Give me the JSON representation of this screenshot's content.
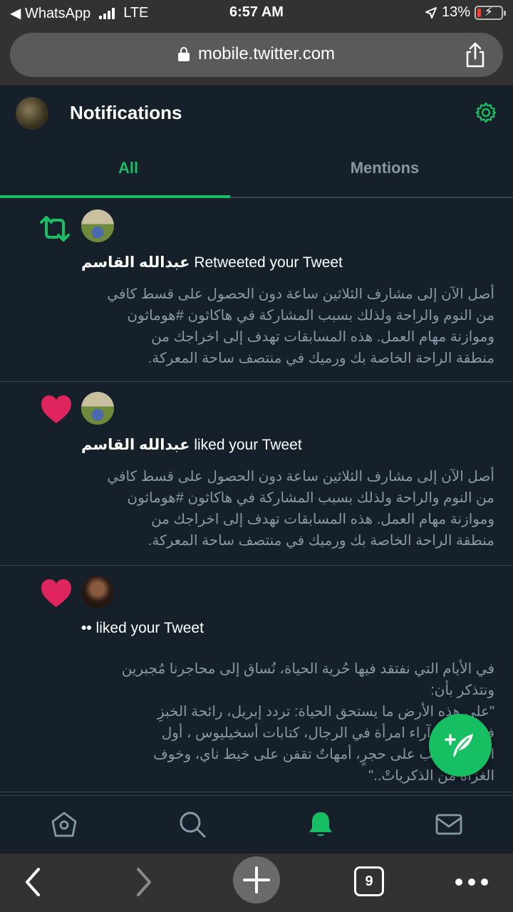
{
  "status_bar": {
    "back_app": "◀ WhatsApp",
    "carrier": "LTE",
    "time": "6:57 AM",
    "battery": "13%"
  },
  "browser": {
    "url": "mobile.twitter.com",
    "tab_count": "9"
  },
  "header": {
    "title": "Notifications"
  },
  "tabs": [
    {
      "label": "All",
      "active": true
    },
    {
      "label": "Mentions",
      "active": false
    }
  ],
  "notifications": [
    {
      "type": "retweet",
      "actor": "عبدالله القاسم",
      "action": " Retweeted your Tweet",
      "tweet_lines": [
        "أصل الآن إلى مشارف الثلاثين ساعة دون الحصول على قسط كافي",
        "من النوم والراحة ولذلك بسبب المشاركة في هاكاثون #هوماثون",
        "وموازنة مهام العمل. هذه المسابقات تهدف إلى اخراجك من",
        "منطقة الراحة الخاصة بك ورميك في منتصف ساحة المعركة."
      ]
    },
    {
      "type": "like",
      "actor": "عبدالله القاسم",
      "action": " liked your Tweet",
      "tweet_lines": [
        "أصل الآن إلى مشارف الثلاثين ساعة دون الحصول على قسط كافي",
        "من النوم والراحة ولذلك بسبب المشاركة في هاكاثون #هوماثون",
        "وموازنة مهام العمل. هذه المسابقات تهدف إلى اخراجك من",
        "منطقة الراحة الخاصة بك ورميك في منتصف ساحة المعركة."
      ]
    },
    {
      "type": "like",
      "actor": "••",
      "action": " liked your Tweet",
      "tweet_lines": [
        "في الأيام التي نفتقد فيها حُرية الحياة، نُساق إلى محاجرنا مُجبرين",
        "ونتذكر بأن:",
        "\"على هذه الأرض ما يستحق الحياة: تردد إبريل، رائحة الخبزِ",
        "في الفجر، آراء امرأة في الرجال، كتابات أسخيليوس ، أول",
        "الحب، عشب على حجرٍ، أمهاتٌ تقفن على خيط ناي، وخوف",
        "الغزاة من الذكرياتْ..\""
      ]
    }
  ],
  "colors": {
    "background": "#15202b",
    "accent_green": "#17bf63",
    "muted_text": "#8899a6",
    "heart_red": "#e0245e",
    "divider": "#38444d"
  },
  "icons": {
    "retweet": "retweet-icon",
    "like": "heart-icon",
    "compose": "compose-tweet-icon",
    "home": "home-icon",
    "search": "search-icon",
    "notifications": "bell-icon",
    "messages": "mail-icon",
    "settings": "gear-icon"
  }
}
